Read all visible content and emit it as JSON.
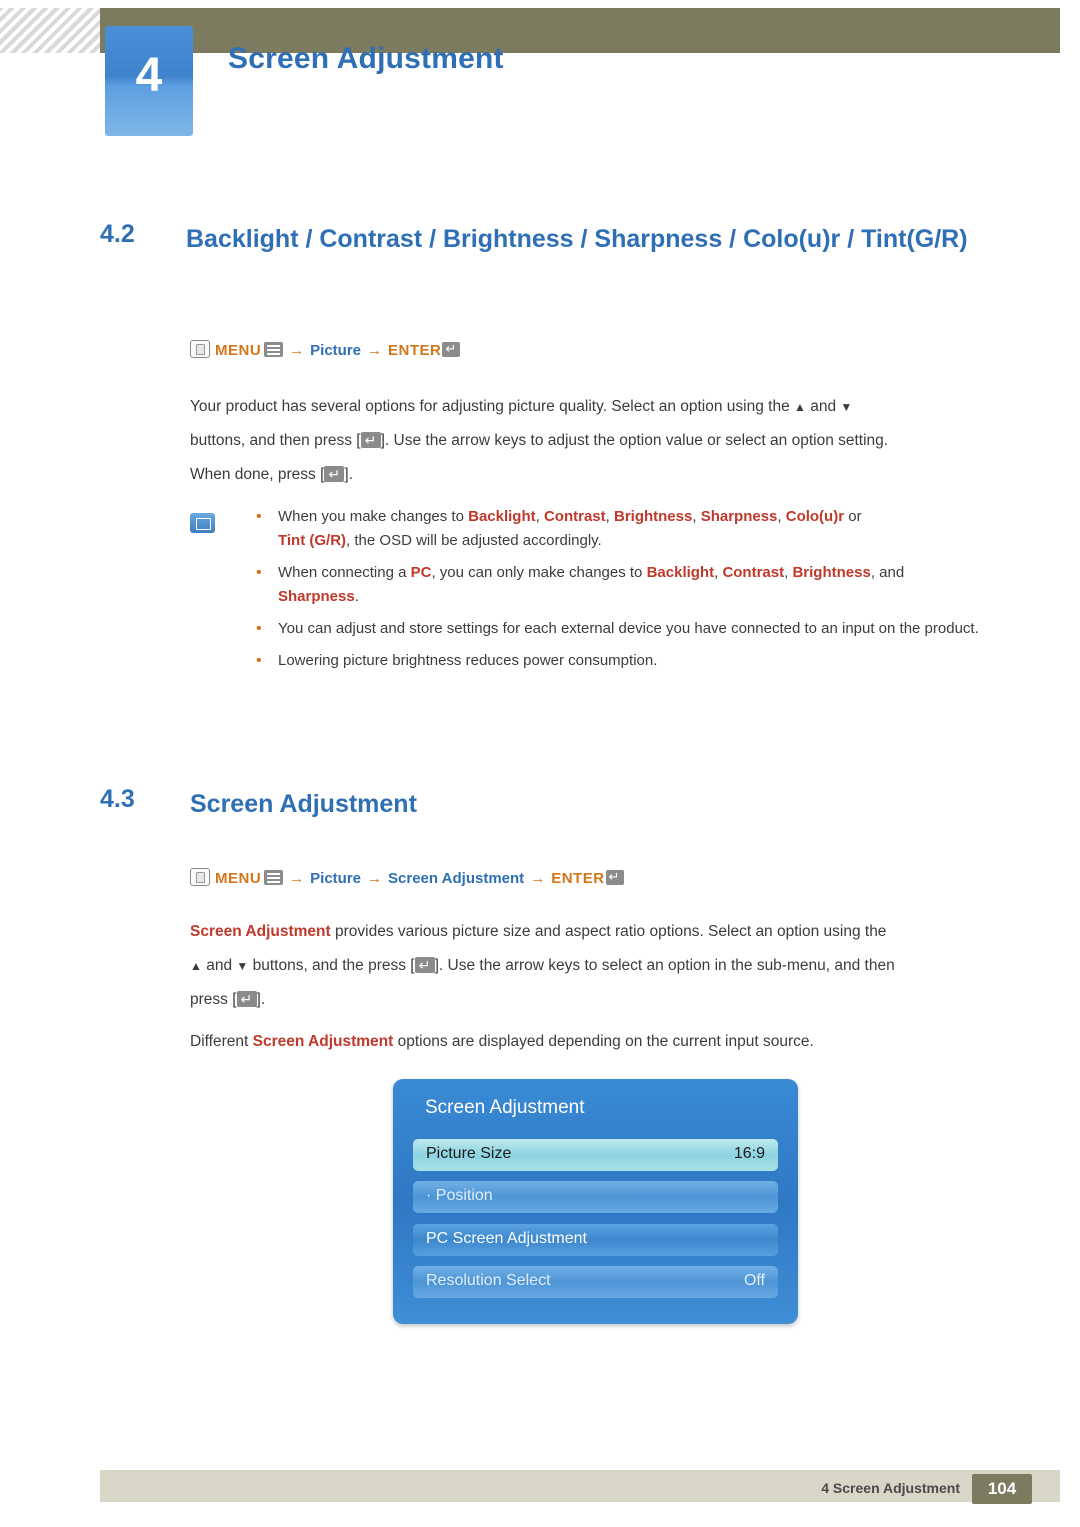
{
  "header": {
    "chapter_number": "4",
    "title": "Screen Adjustment"
  },
  "section_42": {
    "number": "4.2",
    "title": "Backlight / Contrast / Brightness / Sharpness / Colo(u)r / Tint(G/R)",
    "path": {
      "menu_label": "MENU",
      "picture_label": "Picture",
      "enter_label": "ENTER"
    },
    "paragraph": {
      "p1": "Your product has several options for adjusting picture quality. Select an option using the",
      "p1b": "and",
      "p2a": "buttons, and then press [",
      "p2b": "]. Use the arrow keys to adjust the option value or select an option setting.",
      "p3a": "When done, press [",
      "p3b": "]."
    },
    "notes": [
      {
        "pre": "When you make changes to ",
        "kw1": "Backlight",
        "kw2": "Contrast",
        "kw3": "Brightness",
        "kw4": "Sharpness",
        "kw5": "Colo(u)r",
        "mid": " or",
        "kw6": "Tint (G/R)",
        "post": ", the OSD will be adjusted accordingly."
      },
      {
        "pre": "When connecting a ",
        "kw1": "PC",
        "mid": ", you can only make changes to ",
        "kw2": "Backlight",
        "kw3": "Contrast",
        "kw4": "Brightness",
        "post": ", and",
        "kw5": "Sharpness",
        "end": "."
      },
      {
        "text": "You can adjust and store settings for each external device you have connected to an input on the product."
      },
      {
        "text": "Lowering picture brightness reduces power consumption."
      }
    ]
  },
  "section_43": {
    "number": "4.3",
    "title": "Screen Adjustment",
    "path": {
      "menu_label": "MENU",
      "picture_label": "Picture",
      "screen_adjustment_label": "Screen Adjustment",
      "enter_label": "ENTER"
    },
    "paragraph": {
      "kw_lead": "Screen Adjustment",
      "p1": " provides various picture size and aspect ratio options. Select an option using the",
      "p2a": "and",
      "p2b": "buttons, and the press [",
      "p2c": "]. Use the arrow keys to select an option in the sub-menu, and then",
      "p3a": "press [",
      "p3b": "].",
      "p4a": "Different ",
      "p4_kw": "Screen Adjustment",
      "p4b": " options are displayed depending on the current input source."
    },
    "osd": {
      "title": "Screen Adjustment",
      "rows": [
        {
          "label": "Picture Size",
          "value": "16:9",
          "style": "sel"
        },
        {
          "label": "· Position",
          "value": "",
          "style": "dim"
        },
        {
          "label": "PC Screen Adjustment",
          "value": "",
          "style": "norm"
        },
        {
          "label": "Resolution Select",
          "value": "Off",
          "style": "dim"
        }
      ]
    }
  },
  "footer": {
    "text": "4 Screen Adjustment",
    "page": "104"
  },
  "colors": {
    "heading_blue": "#2f6fb5",
    "keyword_orange": "#d4761a",
    "keyword_red": "#c0392b",
    "header_olive": "#7c7a5f"
  }
}
